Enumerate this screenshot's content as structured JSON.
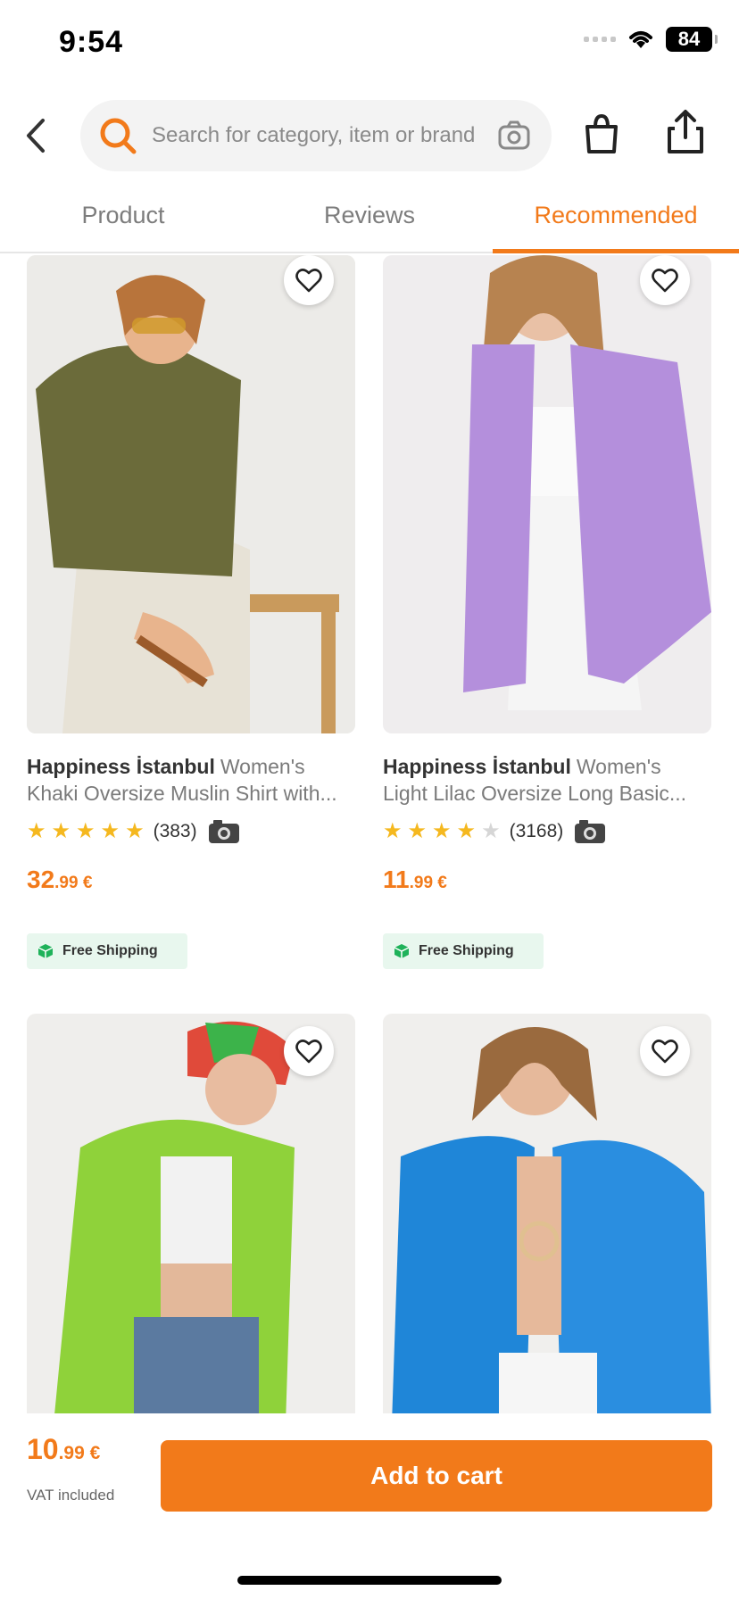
{
  "status_bar": {
    "time": "9:54",
    "battery": "84"
  },
  "header": {
    "search_placeholder": "Search for category, item or brand"
  },
  "tabs": [
    {
      "label": "Product"
    },
    {
      "label": "Reviews"
    },
    {
      "label": "Recommended",
      "active": true
    }
  ],
  "accent_color": "#f27a1a",
  "products": [
    {
      "brand": "Happiness İstanbul",
      "name_part1": "Women's",
      "name_part2": "Khaki Oversize Muslin Shirt with...",
      "rating": 5,
      "review_count": "(383)",
      "price_int": "32",
      "price_dec": ".99 €",
      "badge": "Free Shipping",
      "shirt_color": "#6b6b3a"
    },
    {
      "brand": "Happiness İstanbul",
      "name_part1": "Women's",
      "name_part2": "Light Lilac Oversize Long Basic...",
      "rating": 4,
      "review_count": "(3168)",
      "price_int": "11",
      "price_dec": ".99 €",
      "badge": "Free Shipping",
      "shirt_color": "#b48fdc"
    },
    {
      "shirt_color": "#8fd23a"
    },
    {
      "shirt_color": "#1f86d8"
    }
  ],
  "bottom_bar": {
    "price_int": "10",
    "price_dec": ".99 €",
    "vat_note": "VAT included",
    "add_to_cart": "Add to cart"
  }
}
